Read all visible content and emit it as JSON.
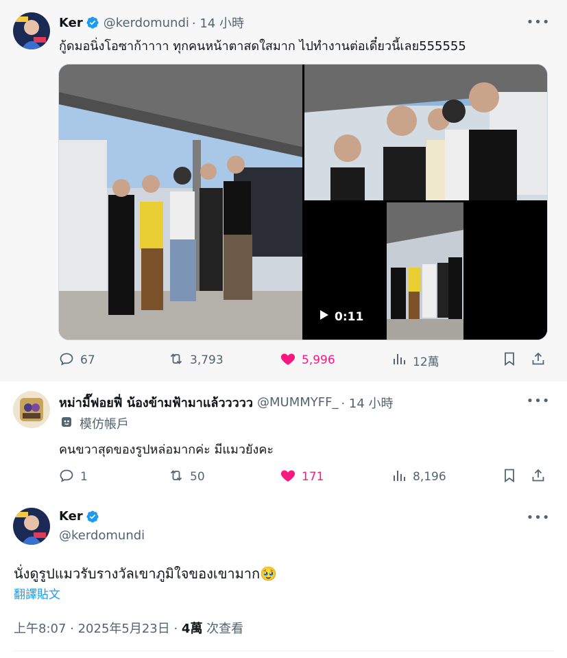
{
  "tweet1": {
    "name": "Ker",
    "handle": "@kerdomundi",
    "time": "· 14 小時",
    "text": "กู้ดมอนิ่งโอซาก้าาาา ทุกคนหน้าตาสดใสมาก ไปทำงานต่อเดี๋ยวนี้เลย555555",
    "video_duration": "0:11",
    "more_icon": "more-horizontal-icon",
    "stats": {
      "replies": "67",
      "reposts": "3,793",
      "likes": "5,996",
      "views": "12萬"
    }
  },
  "tweet2": {
    "name": "หม่ามี๊ฟอยฟี่ น้องข้ามฟ้ามาแล้ววววว",
    "handle": "@MUMMYFF_",
    "time": "· 14 小時",
    "imposter_label": "模仿帳戶",
    "text": "คนขวาสุดของรูปหล่อมากค่ะ มีแมวยังคะ",
    "stats": {
      "replies": "1",
      "reposts": "50",
      "likes": "171",
      "views": "8,196"
    }
  },
  "tweet3": {
    "name": "Ker",
    "handle": "@kerdomundi",
    "text": "นั่งดูรูปแมวรับรางวัลเขาภูมิใจของเขามาก🥹",
    "translate": "翻譯貼文",
    "timestamp": "上午8:07 · 2025年5月23日 · ",
    "views_count": "4萬",
    "views_label": " 次查看"
  },
  "colors": {
    "like_pink": "#f91880",
    "verified_blue": "#1d9bf0",
    "secondary_text": "#536471",
    "link_blue": "#1d9bf0"
  }
}
